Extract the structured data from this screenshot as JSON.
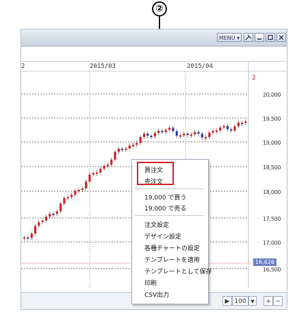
{
  "annotation": {
    "number": "②"
  },
  "window": {
    "menu_button_label": "MENU ▾",
    "top_right_marker": "2"
  },
  "chart": {
    "month_labels": [
      "2",
      "2015/03",
      "2015/04"
    ],
    "y_axis_labels": [
      "20,000",
      "19,500",
      "19,000",
      "18,500",
      "18,000",
      "17,500",
      "17,000",
      "16,500"
    ],
    "current_price_tag": "16,626"
  },
  "context_menu": {
    "items": [
      {
        "label": "買注文"
      },
      {
        "label": "売注文"
      },
      {
        "label": "19,000 で買う"
      },
      {
        "label": "19,000 で売る"
      },
      {
        "label": "注文設定"
      },
      {
        "label": "デザイン設定"
      },
      {
        "label": "各種チャートの設定"
      },
      {
        "label": "テンプレートを適用"
      },
      {
        "label": "テンプレートとして保存"
      },
      {
        "label": "印刷"
      },
      {
        "label": "CSV出力"
      }
    ]
  },
  "statusbar": {
    "play_icon": "▶",
    "count_value": "100",
    "dropdown_icon": "▼",
    "plus_label": "+",
    "minus_label": "−"
  },
  "colors": {
    "up": "#d81f26",
    "down": "#2b3aa8",
    "highlight": "#d81f26"
  },
  "icons": [
    "pin-icon",
    "minimize-icon",
    "maximize-icon",
    "close-icon"
  ]
}
